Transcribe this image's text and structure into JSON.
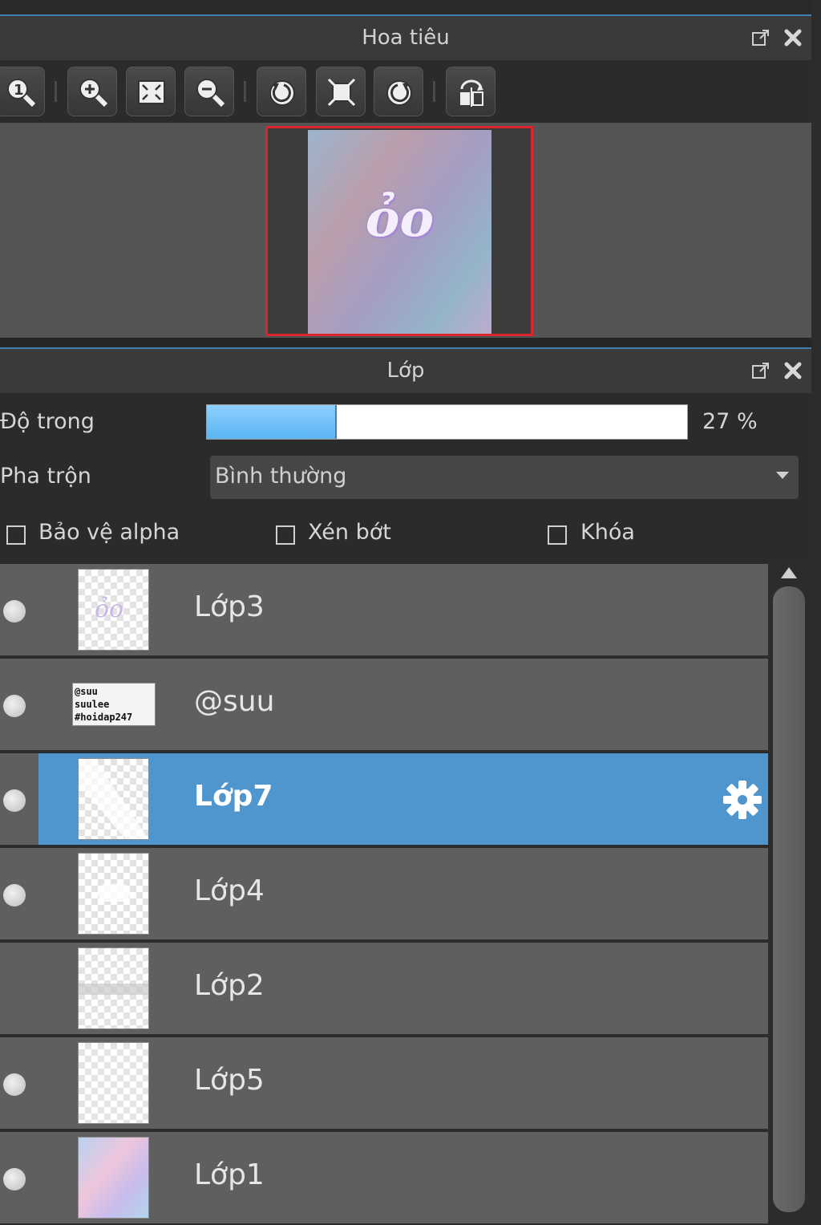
{
  "navigator": {
    "title": "Hoa tiêu",
    "art_text": "ỏo"
  },
  "layers_panel": {
    "title": "Lớp",
    "opacity_label": "Độ trong",
    "opacity_value_text": "27 %",
    "opacity_fraction": 0.27,
    "blend_label": "Pha trộn",
    "blend_value": "Bình thường",
    "checkboxes": {
      "protect_alpha": "Bảo vệ alpha",
      "clipping": "Xén bớt",
      "lock": "Khóa"
    },
    "layers": [
      {
        "name": "Lớp3",
        "visible": true,
        "selected": false
      },
      {
        "name": "@suu",
        "visible": true,
        "selected": false,
        "thumb_lines": [
          "@suu",
          "suulee",
          "#hoidap247"
        ]
      },
      {
        "name": "Lớp7",
        "visible": true,
        "selected": true
      },
      {
        "name": "Lớp4",
        "visible": true,
        "selected": false
      },
      {
        "name": "Lớp2",
        "visible": false,
        "selected": false
      },
      {
        "name": "Lớp5",
        "visible": true,
        "selected": false
      },
      {
        "name": "Lớp1",
        "visible": true,
        "selected": false
      }
    ]
  },
  "colors": {
    "selection": "#4f96cf",
    "accent_border": "#e0242b",
    "opacity_fill": "#5ab4f2"
  }
}
